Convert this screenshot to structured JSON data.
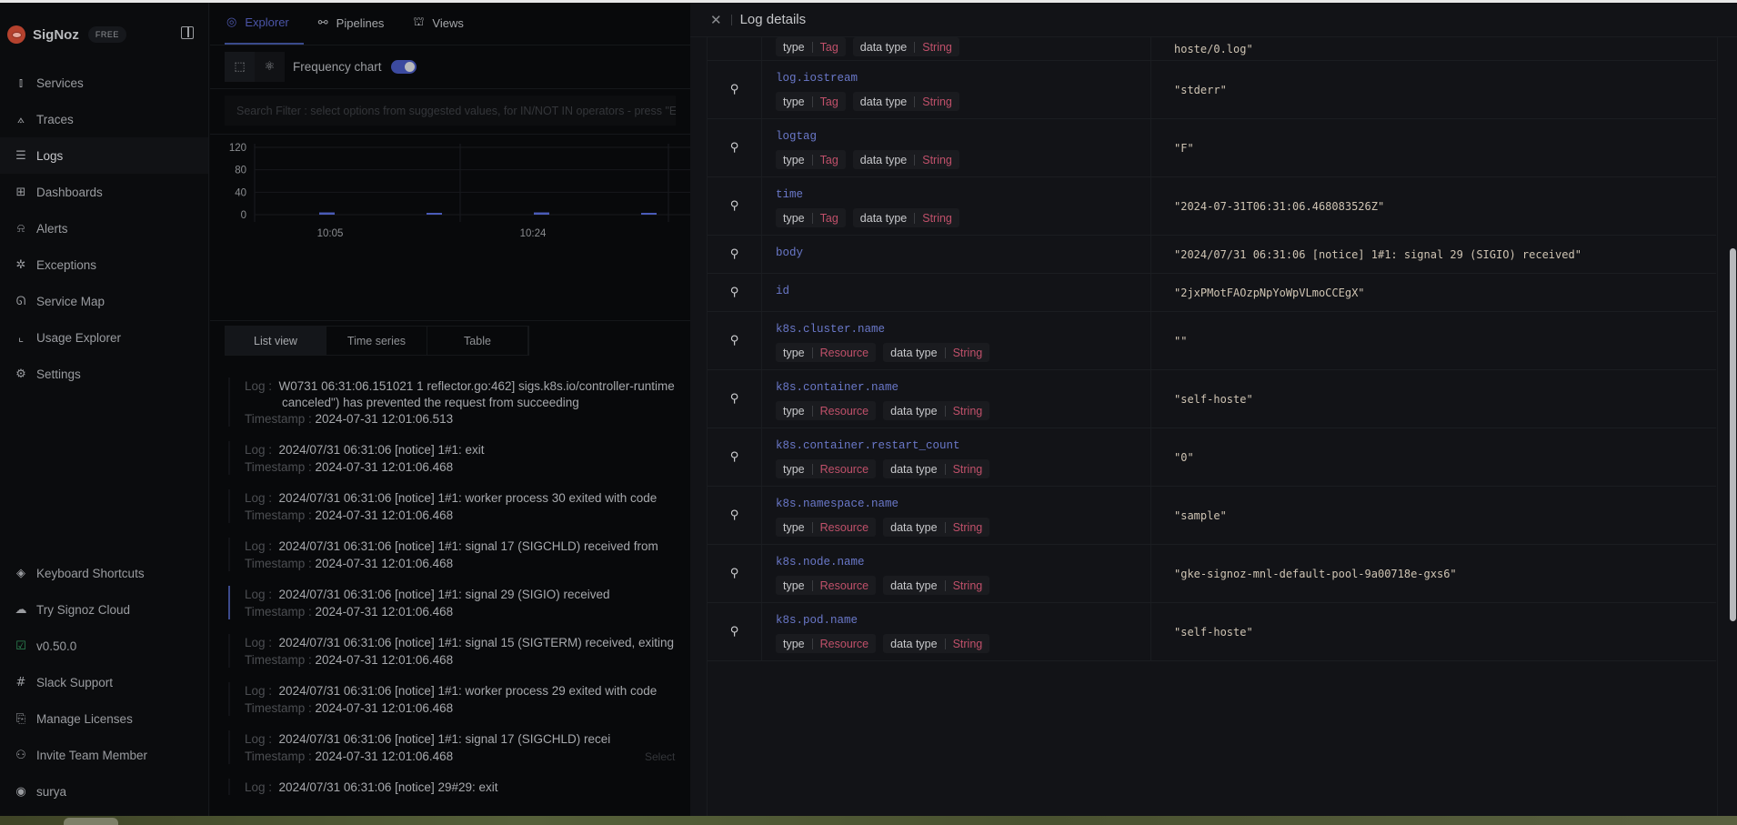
{
  "app": {
    "name": "SigNoz",
    "plan_badge": "FREE"
  },
  "sidebar": {
    "items": [
      {
        "label": "Services",
        "icon": "bar-chart-icon",
        "glyph": "⫾"
      },
      {
        "label": "Traces",
        "icon": "draft-compass-icon",
        "glyph": "⟑"
      },
      {
        "label": "Logs",
        "icon": "scroll-text-icon",
        "glyph": "☰",
        "active": true
      },
      {
        "label": "Dashboards",
        "icon": "layout-grid-icon",
        "glyph": "⊞"
      },
      {
        "label": "Alerts",
        "icon": "bell-dot-icon",
        "glyph": "⍾"
      },
      {
        "label": "Exceptions",
        "icon": "bug-icon",
        "glyph": "✲"
      },
      {
        "label": "Service Map",
        "icon": "route-icon",
        "glyph": "ᘏ"
      },
      {
        "label": "Usage Explorer",
        "icon": "area-chart-icon",
        "glyph": "⌞"
      },
      {
        "label": "Settings",
        "icon": "gear-icon",
        "glyph": "⚙"
      }
    ],
    "bottom_items": [
      {
        "label": "Keyboard Shortcuts",
        "icon": "layers-icon",
        "glyph": "◈"
      },
      {
        "label": "Try Signoz Cloud",
        "icon": "cloud-icon",
        "glyph": "☁"
      },
      {
        "label": "v0.50.0",
        "icon": "check-square-icon",
        "glyph": "☑"
      },
      {
        "label": "Slack Support",
        "icon": "slack-icon",
        "glyph": "#"
      },
      {
        "label": "Manage Licenses",
        "icon": "file-key-icon",
        "glyph": "⎘"
      },
      {
        "label": "Invite Team Member",
        "icon": "user-plus-icon",
        "glyph": "⚇"
      },
      {
        "label": "surya",
        "icon": "user-circle-icon",
        "glyph": "◉"
      }
    ]
  },
  "main": {
    "tabs": [
      {
        "label": "Explorer",
        "glyph": "◎",
        "active": true
      },
      {
        "label": "Pipelines",
        "glyph": "⚯"
      },
      {
        "label": "Views",
        "glyph": "⛫"
      }
    ],
    "toolbar": {
      "frequency_chart_label": "Frequency chart",
      "frequency_chart_enabled": true
    },
    "search": {
      "placeholder": "Search Filter : select options from suggested values, for IN/NOT IN operators - press \"Enter\" after selecting options"
    },
    "view_tabs": [
      {
        "label": "List view",
        "active": true
      },
      {
        "label": "Time series"
      },
      {
        "label": "Table"
      }
    ],
    "log_label": "Log :",
    "timestamp_label": "Timestamp :",
    "logs": [
      {
        "log": "W0731 06:31:06.151021 1 reflector.go:462] sigs.k8s.io/controller-runtime",
        "log_cont": "canceled\") has prevented the request from succeeding",
        "timestamp": "2024-07-31 12:01:06.513"
      },
      {
        "log": "2024/07/31 06:31:06 [notice] 1#1: exit",
        "timestamp": "2024-07-31 12:01:06.468"
      },
      {
        "log": "2024/07/31 06:31:06 [notice] 1#1: worker process 30 exited with code",
        "timestamp": "2024-07-31 12:01:06.468"
      },
      {
        "log": "2024/07/31 06:31:06 [notice] 1#1: signal 17 (SIGCHLD) received from",
        "timestamp": "2024-07-31 12:01:06.468"
      },
      {
        "log": "2024/07/31 06:31:06 [notice] 1#1: signal 29 (SIGIO) received",
        "timestamp": "2024-07-31 12:01:06.468",
        "selected": true
      },
      {
        "log": "2024/07/31 06:31:06 [notice] 1#1: signal 15 (SIGTERM) received, exiting",
        "timestamp": "2024-07-31 12:01:06.468"
      },
      {
        "log": "2024/07/31 06:31:06 [notice] 1#1: worker process 29 exited with code",
        "timestamp": "2024-07-31 12:01:06.468"
      },
      {
        "log": "2024/07/31 06:31:06 [notice] 1#1: signal 17 (SIGCHLD) recei",
        "timestamp": "2024-07-31 12:01:06.468"
      },
      {
        "log": "2024/07/31 06:31:06 [notice] 29#29: exit",
        "timestamp": ""
      }
    ],
    "select_ghost": "Select"
  },
  "chart_data": {
    "type": "bar",
    "title": "",
    "xlabel": "",
    "ylabel": "",
    "ylim": [
      0,
      120
    ],
    "y_ticks": [
      "0",
      "40",
      "80",
      "120"
    ],
    "x_tick_labels": [
      "10:05",
      "10:24"
    ],
    "categories": [
      "10:05",
      "~10:15",
      "10:24",
      "~10:34"
    ],
    "values": [
      4,
      2,
      4,
      2
    ],
    "grid": true,
    "series_color": "#4a5bb8"
  },
  "drawer": {
    "title": "Log details",
    "type_label": "type",
    "data_type_label": "data type",
    "rows": [
      {
        "key": "",
        "type": "Tag",
        "data_type": "String",
        "value": "hoste/0.log\"",
        "partial": true
      },
      {
        "key": "log.iostream",
        "type": "Tag",
        "data_type": "String",
        "value": "\"stderr\""
      },
      {
        "key": "logtag",
        "type": "Tag",
        "data_type": "String",
        "value": "\"F\""
      },
      {
        "key": "time",
        "type": "Tag",
        "data_type": "String",
        "value": "\"2024-07-31T06:31:06.468083526Z\""
      },
      {
        "key": "body",
        "value": "\"2024/07/31 06:31:06 [notice] 1#1: signal 29 (SIGIO) received\""
      },
      {
        "key": "id",
        "value": "\"2jxPMotFAOzpNpYoWpVLmoCCEgX\""
      },
      {
        "key": "k8s.cluster.name",
        "type": "Resource",
        "data_type": "String",
        "value": "\"\""
      },
      {
        "key": "k8s.container.name",
        "type": "Resource",
        "data_type": "String",
        "value": "\"self-hoste\""
      },
      {
        "key": "k8s.container.restart_count",
        "type": "Resource",
        "data_type": "String",
        "value": "\"0\""
      },
      {
        "key": "k8s.namespace.name",
        "type": "Resource",
        "data_type": "String",
        "value": "\"sample\""
      },
      {
        "key": "k8s.node.name",
        "type": "Resource",
        "data_type": "String",
        "value": "\"gke-signoz-mnl-default-pool-9a00718e-gxs6\""
      },
      {
        "key": "k8s.pod.name",
        "type": "Resource",
        "data_type": "String",
        "value": "\"self-hoste\""
      }
    ]
  },
  "colors": {
    "accent": "#3c4aa0",
    "key_text": "#6a78c9",
    "chip_value": "#c0506a",
    "value_text": "#cfc4b3"
  }
}
